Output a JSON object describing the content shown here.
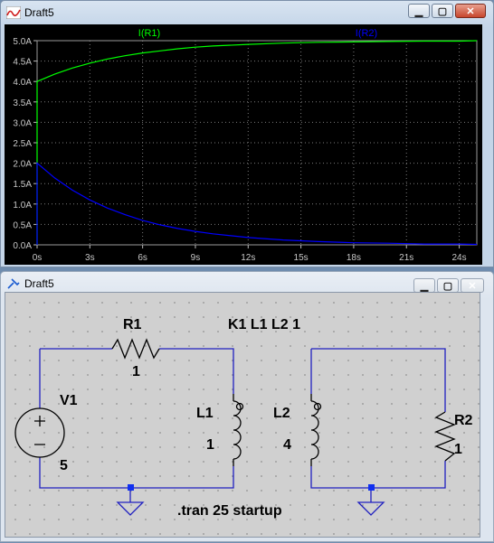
{
  "waveform_window": {
    "title": "Draft5",
    "buttons": {
      "minimize": "▁",
      "maximize": "▢",
      "close": "✕"
    }
  },
  "chart_data": {
    "type": "line",
    "xlabel": "",
    "ylabel": "",
    "xlim": [
      0,
      25
    ],
    "ylim": [
      0,
      5
    ],
    "x_ticks": [
      "0s",
      "3s",
      "6s",
      "9s",
      "12s",
      "15s",
      "18s",
      "21s",
      "24s"
    ],
    "y_ticks": [
      "0.0A",
      "0.5A",
      "1.0A",
      "1.5A",
      "2.0A",
      "2.5A",
      "3.0A",
      "3.5A",
      "4.0A",
      "4.5A",
      "5.0A"
    ],
    "grid": true,
    "series": [
      {
        "name": "I(R1)",
        "color": "#00ff00",
        "x": [
          0,
          1,
          2,
          3,
          4,
          5,
          6,
          7,
          8,
          9,
          10,
          12,
          14,
          16,
          18,
          20,
          22,
          24,
          25
        ],
        "y": [
          4.0,
          4.18,
          4.33,
          4.45,
          4.55,
          4.63,
          4.7,
          4.75,
          4.8,
          4.84,
          4.87,
          4.91,
          4.94,
          4.96,
          4.97,
          4.98,
          4.99,
          4.99,
          5.0
        ]
      },
      {
        "name": "I(R2)",
        "color": "#0000ff",
        "x": [
          0,
          1,
          2,
          3,
          4,
          5,
          6,
          7,
          8,
          9,
          10,
          12,
          14,
          16,
          18,
          20,
          22,
          24,
          25
        ],
        "y": [
          2.0,
          1.64,
          1.34,
          1.1,
          0.9,
          0.74,
          0.6,
          0.49,
          0.4,
          0.33,
          0.27,
          0.18,
          0.12,
          0.08,
          0.05,
          0.04,
          0.02,
          0.02,
          0.01
        ]
      }
    ]
  },
  "schematic_window": {
    "title": "Draft5",
    "buttons": {
      "minimize": "▁",
      "maximize": "▢",
      "close": "✕"
    },
    "labels": {
      "r1_name": "R1",
      "r1_value": "1",
      "coupling": "K1 L1 L2 1",
      "v1_name": "V1",
      "v1_value": "5",
      "l1_name": "L1",
      "l1_value": "1",
      "l2_name": "L2",
      "l2_value": "4",
      "r2_name": "R2",
      "r2_value": "1",
      "directive": ".tran 25 startup"
    }
  }
}
